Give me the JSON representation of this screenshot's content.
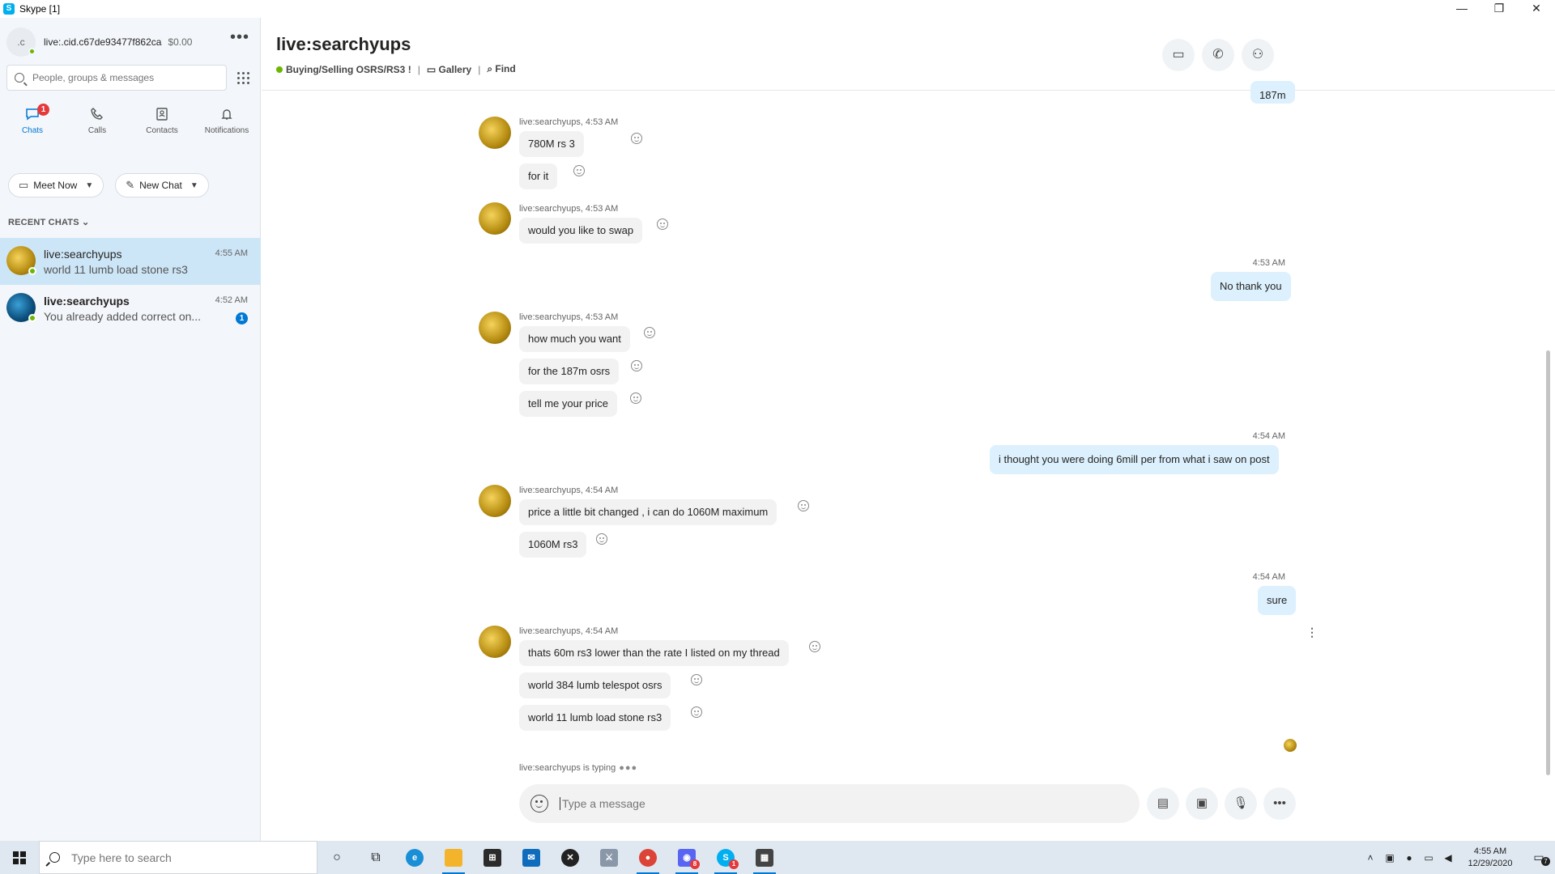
{
  "window": {
    "title": "Skype [1]",
    "app_icon_letter": "S",
    "controls": {
      "minimize": "—",
      "restore": "❐",
      "close": "✕"
    }
  },
  "sidebar": {
    "profile": {
      "initials": ".c",
      "name": "live:.cid.c67de93477f862ca",
      "credit": "$0.00",
      "more": "•••"
    },
    "search": {
      "placeholder": "People, groups & messages"
    },
    "nav": [
      {
        "label": "Chats",
        "badge": "1",
        "active": true
      },
      {
        "label": "Calls"
      },
      {
        "label": "Contacts"
      },
      {
        "label": "Notifications"
      }
    ],
    "buttons": {
      "meet_now": "Meet Now",
      "new_chat": "New Chat"
    },
    "recent_title": "RECENT CHATS",
    "chats": [
      {
        "name": "live:searchyups",
        "preview": "world 11 lumb load stone rs3",
        "time": "4:55 AM",
        "selected": true
      },
      {
        "name": "live:searchyups",
        "preview": "You already added correct on...",
        "time": "4:52 AM",
        "unread": "1"
      }
    ]
  },
  "header": {
    "title": "live:searchyups",
    "mood": "Buying/Selling OSRS/RS3 !",
    "sep1": "|",
    "gallery": "Gallery",
    "sep2": "|",
    "find": "Find"
  },
  "messages": {
    "top_partial": "187m",
    "sender_label_1": "live:searchyups, 4:53 AM",
    "m1": "780M rs 3",
    "m2": "for it",
    "sender_label_2": "live:searchyups, 4:53 AM",
    "m3": "would you like to swap",
    "out_time_1": "4:53 AM",
    "o1": "No thank you",
    "sender_label_3": "live:searchyups, 4:53 AM",
    "m4": "how much you want",
    "m5": "for the 187m osrs",
    "m6": "tell me your price",
    "out_time_2": "4:54 AM",
    "o2": "i thought you were doing 6mill per from what i saw on post",
    "sender_label_4": "live:searchyups, 4:54 AM",
    "m7": "price a little bit changed , i can do 1060M maximum",
    "m8": "1060M rs3",
    "out_time_3": "4:54 AM",
    "o3": "sure",
    "sender_label_5": "live:searchyups, 4:54 AM",
    "m9": "thats 60m rs3 lower than the rate I listed on my thread",
    "m10": "world 384 lumb telespot osrs",
    "m11": "world 11 lumb load stone rs3",
    "kebab": "⋮",
    "typing": "live:searchyups is typing",
    "typing_dots": "●●●"
  },
  "composer": {
    "placeholder": "Type a message"
  },
  "taskbar": {
    "search_placeholder": "Type here to search",
    "time": "4:55 AM",
    "date": "12/29/2020",
    "notifications": "7",
    "skype_badge": "1",
    "discord_badge": "8"
  },
  "colors": {
    "accent": "#0078d4",
    "online": "#6bb700",
    "selected_chat": "#cde6f7",
    "outgoing_bubble": "#dcf0fd",
    "incoming_bubble": "#f2f2f2"
  }
}
